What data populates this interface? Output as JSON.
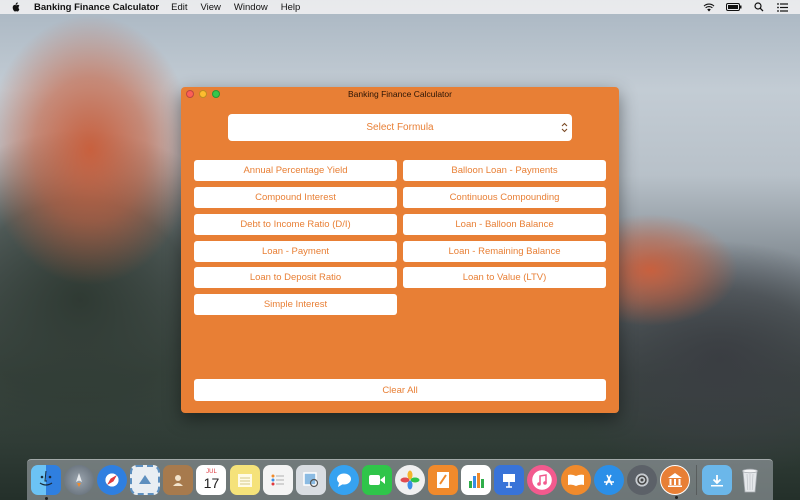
{
  "menubar": {
    "app_name": "Banking Finance Calculator",
    "items": [
      "Edit",
      "View",
      "Window",
      "Help"
    ],
    "status_icons": [
      "wifi-icon",
      "battery-icon",
      "spotlight-search-icon",
      "notification-center-icon"
    ]
  },
  "window": {
    "title": "Banking Finance Calculator",
    "background_color": "#e87f35",
    "select_formula": "Select Formula",
    "buttons_left": [
      "Annual Percentage Yield",
      "Compound Interest",
      "Debt to Income Ratio (D/I)",
      "Loan - Payment",
      "Loan to Deposit Ratio",
      "Simple Interest"
    ],
    "buttons_right": [
      "Balloon Loan - Payments",
      "Continuous Compounding",
      "Loan - Balloon Balance",
      "Loan - Remaining Balance",
      "Loan to Value (LTV)"
    ],
    "clear_all": "Clear All"
  },
  "dock": {
    "apps": [
      {
        "name": "finder-icon",
        "color": "#3a8ee6"
      },
      {
        "name": "launchpad-icon",
        "color": "#7d8894"
      },
      {
        "name": "safari-icon",
        "color": "#2f7fe0"
      },
      {
        "name": "mail-stamp-icon",
        "color": "#5d8fbf"
      },
      {
        "name": "contacts-icon",
        "color": "#a77a4d"
      },
      {
        "name": "calendar-icon",
        "color": "#ffffff"
      },
      {
        "name": "notes-icon",
        "color": "#f5e27a"
      },
      {
        "name": "reminders-icon",
        "color": "#f4f4f4"
      },
      {
        "name": "preview-icon",
        "color": "#d9dde2"
      },
      {
        "name": "messages-icon",
        "color": "#36a2f0"
      },
      {
        "name": "facetime-icon",
        "color": "#2fc54a"
      },
      {
        "name": "photos-icon",
        "color": "#f0f0f0"
      },
      {
        "name": "pages-icon",
        "color": "#f08a2c"
      },
      {
        "name": "numbers-icon",
        "color": "#2fae4a"
      },
      {
        "name": "keynote-icon",
        "color": "#3873d8"
      },
      {
        "name": "itunes-icon",
        "color": "#f25a8e"
      },
      {
        "name": "ibooks-icon",
        "color": "#f08a2c"
      },
      {
        "name": "app-store-icon",
        "color": "#2b8fe8"
      },
      {
        "name": "system-preferences-icon",
        "color": "#8b8f95"
      },
      {
        "name": "banking-calculator-icon",
        "color": "#e87f35"
      }
    ],
    "calendar_day": "17",
    "calendar_month": "JUL",
    "trailing": [
      {
        "name": "downloads-folder-icon",
        "color": "#6bb7ea"
      },
      {
        "name": "trash-icon",
        "color": "#d4d8dc"
      }
    ]
  }
}
